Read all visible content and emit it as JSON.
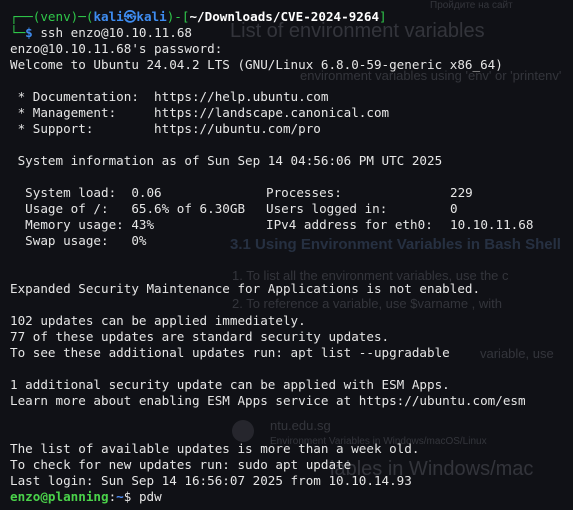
{
  "prompt_header": {
    "prefix": "┌──",
    "venv": "(venv)",
    "sep": "─",
    "open_paren": "(",
    "user_host": "kali㉿kali",
    "close_paren": ")",
    "dash_bracket": "-[",
    "cwd": "~/Downloads/CVE-2024-9264",
    "close_bracket": "]"
  },
  "command_line": {
    "prefix": "└─",
    "dollar": "$",
    "command": " ssh enzo@10.10.11.68"
  },
  "lines": {
    "password": "enzo@10.10.11.68's password:",
    "welcome": "Welcome to Ubuntu 24.04.2 LTS (GNU/Linux 6.8.0-59-generic x86_64)",
    "doc": " * Documentation:  https://help.ubuntu.com",
    "mgmt": " * Management:     https://landscape.canonical.com",
    "support": " * Support:        https://ubuntu.com/pro",
    "sysinfo_header": " System information as of Sun Sep 14 04:56:06 PM UTC 2025",
    "esm_disabled": "Expanded Security Maintenance for Applications is not enabled.",
    "updates1": "102 updates can be applied immediately.",
    "updates2": "77 of these updates are standard security updates.",
    "updates3": "To see these additional updates run: apt list --upgradable",
    "esm1": "1 additional security update can be applied with ESM Apps.",
    "esm2": "Learn more about enabling ESM Apps service at https://ubuntu.com/esm",
    "stale1": "The list of available updates is more than a week old.",
    "stale2": "To check for new updates run: sudo apt update",
    "last_login": "Last login: Sun Sep 14 16:56:07 2025 from 10.10.14.93"
  },
  "sysinfo": [
    [
      "  System load:  0.06",
      "Processes:",
      "229"
    ],
    [
      "  Usage of /:   65.6% of 6.30GB",
      "Users logged in:",
      "0"
    ],
    [
      "  Memory usage: 43%",
      "IPv4 address for eth0:",
      "10.10.11.68"
    ],
    [
      "  Swap usage:   0%",
      "",
      ""
    ]
  ],
  "remote_prompt": {
    "user_host": "enzo@planning",
    "colon": ":",
    "path": "~",
    "dollar": "$",
    "command": " pdw"
  },
  "ghost_page": {
    "top_text": "Пройдите на сайт",
    "h1_a": "List of environment variables",
    "p1": "environment variables using 'env' or 'printenv'",
    "h2": "3.1 Using Environment Variables in Bash Shell",
    "p2": "1.  To list all the environment variables, use the c",
    "p3": "2.  To reference a variable, use $varname , with",
    "p4": "variable, use",
    "site": "ntu.edu.sg",
    "site_sub": "Environment Variables in Windows/macOS/Linux",
    "h1_b": "iables in Windows/mac"
  }
}
